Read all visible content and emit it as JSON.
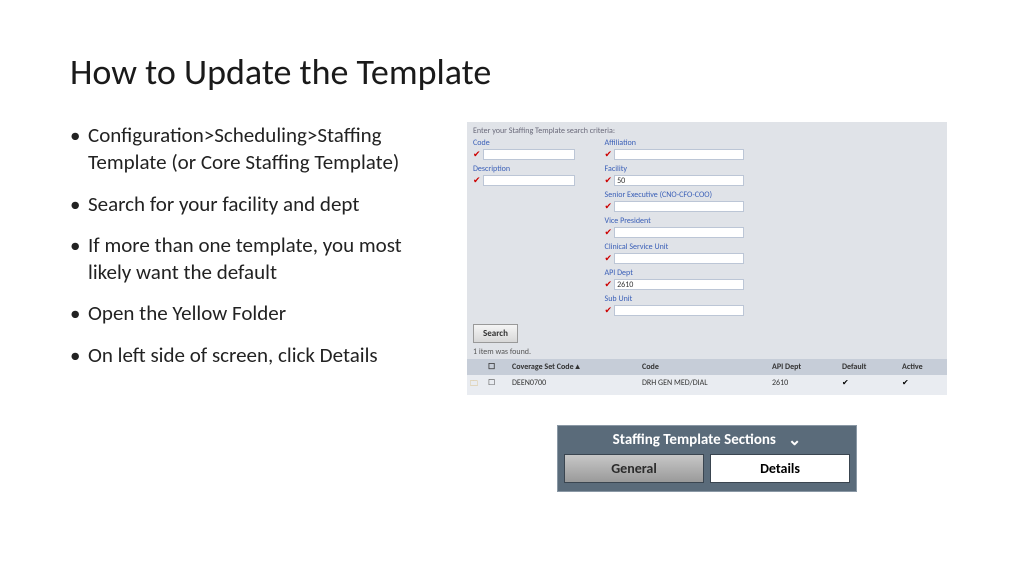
{
  "title": "How to Update the Template",
  "bullets": [
    "Configuration>Scheduling>Staffing Template  (or Core Staffing Template)",
    "Search for your facility and dept",
    "If more than one template, you most likely want the default",
    "Open the Yellow Folder",
    "On left side of screen, click Details"
  ],
  "search_panel": {
    "header": "Enter your Staffing Template search criteria:",
    "left_fields": [
      {
        "label": "Code",
        "value": ""
      },
      {
        "label": "Description",
        "value": ""
      }
    ],
    "right_fields": [
      {
        "label": "Affiliation",
        "value": ""
      },
      {
        "label": "Facility",
        "value": "50"
      },
      {
        "label": "Senior Executive (CNO-CFO-COO)",
        "value": ""
      },
      {
        "label": "Vice President",
        "value": ""
      },
      {
        "label": "Clinical Service Unit",
        "value": ""
      },
      {
        "label": "API Dept",
        "value": "2610"
      },
      {
        "label": "Sub Unit",
        "value": ""
      }
    ],
    "search_btn": "Search",
    "found_text": "1 item was found.",
    "columns": [
      "",
      "",
      "Coverage Set Code▲",
      "Code",
      "API Dept",
      "Default",
      "Active"
    ],
    "row": {
      "coverage": "DEEN0700",
      "code": "DRH GEN MED/DIAL",
      "dept": "2610",
      "def": "✔",
      "active": "✔"
    }
  },
  "sections": {
    "title": "Staffing Template Sections",
    "tab_general": "General",
    "tab_details": "Details"
  }
}
